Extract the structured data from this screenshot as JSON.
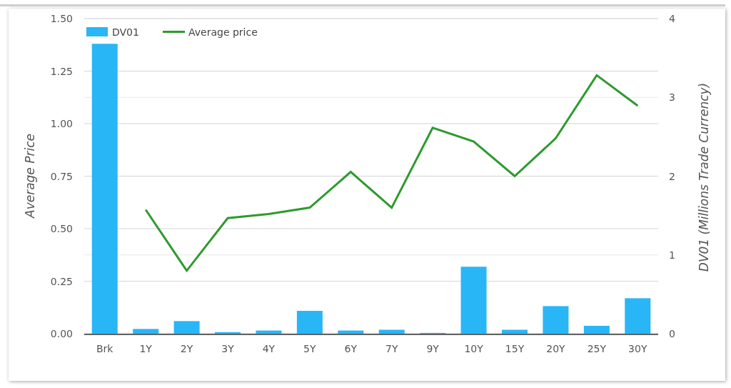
{
  "chart": {
    "chart_data": {
      "type": "bar",
      "grid": true,
      "legend": "top-left",
      "categories": [
        "Brk",
        "1Y",
        "2Y",
        "3Y",
        "4Y",
        "5Y",
        "6Y",
        "7Y",
        "9Y",
        "10Y",
        "15Y",
        "20Y",
        "25Y",
        "30Y"
      ],
      "ylabel": "Average Price",
      "ylim": [
        0,
        1.5
      ],
      "yticks": [
        {
          "value": 0,
          "label": "0.00"
        },
        {
          "value": 0.25,
          "label": "0.25"
        },
        {
          "value": 0.5,
          "label": "0.50"
        },
        {
          "value": 0.75,
          "label": "0.75"
        },
        {
          "value": 1,
          "label": "1.00"
        },
        {
          "value": 1.25,
          "label": "1.25"
        },
        {
          "value": 1.5,
          "label": "1.50"
        }
      ],
      "y2label": "DV01 (Millions Trade Currency)",
      "y2lim": [
        0,
        4
      ],
      "y2ticks": [
        0,
        1,
        2,
        3,
        4
      ],
      "series": [
        {
          "name": "DV01",
          "axis": "y2",
          "color": "#29b6f6",
          "values": [
            3.68,
            0.06,
            0.16,
            0.02,
            0.04,
            0.29,
            0.04,
            0.05,
            0.01,
            0.85,
            0.05,
            0.35,
            0.1,
            0.45
          ]
        },
        {
          "name": "Average price",
          "type": "line",
          "color": "#2e9a2e",
          "values": [
            null,
            0.59,
            0.3,
            0.55,
            0.57,
            0.6,
            0.77,
            0.6,
            0.98,
            0.915,
            0.75,
            0.93,
            1.23,
            1.085
          ]
        }
      ]
    }
  }
}
